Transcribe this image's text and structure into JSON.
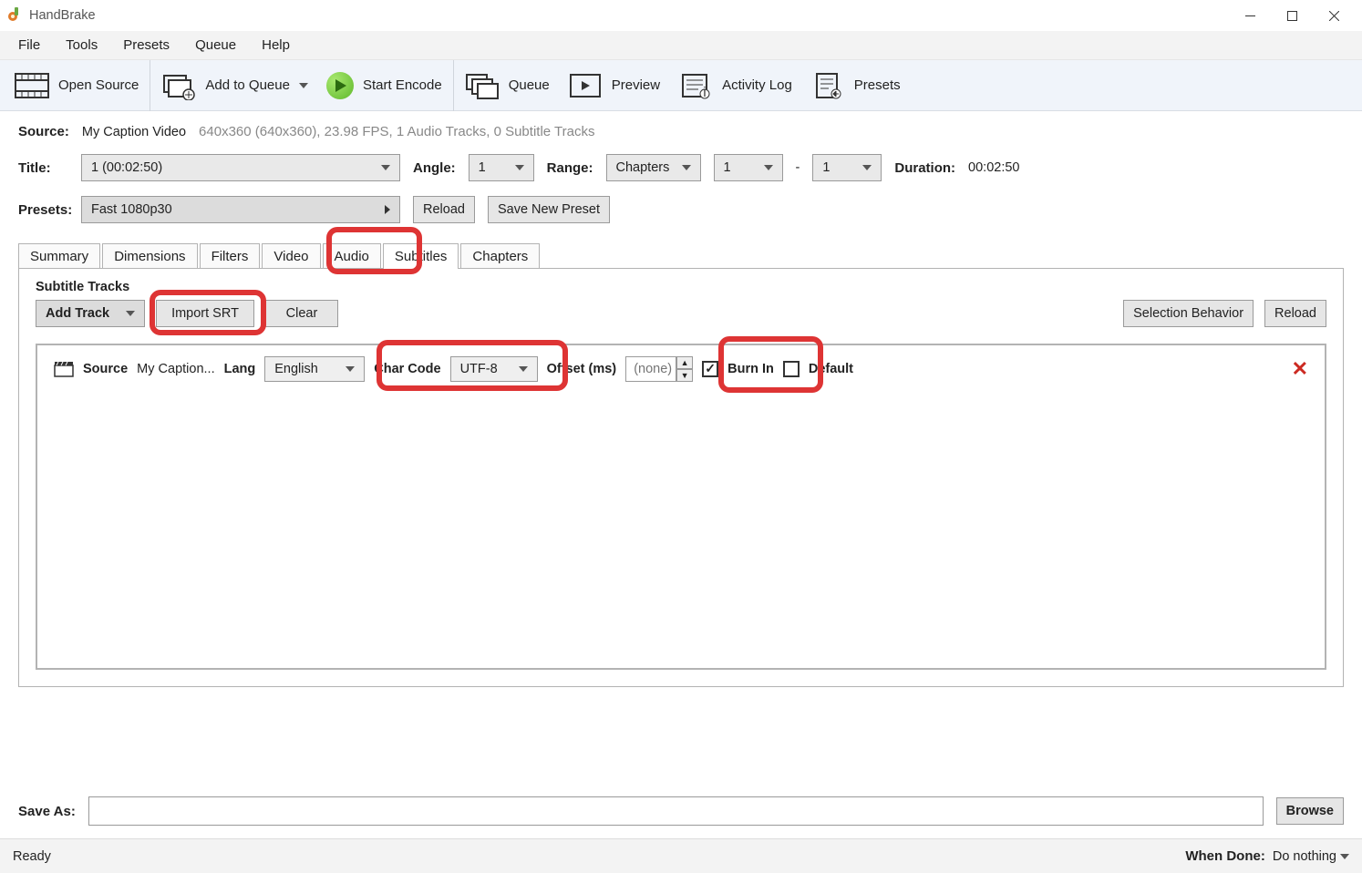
{
  "window": {
    "title": "HandBrake"
  },
  "menu": {
    "file": "File",
    "tools": "Tools",
    "presets": "Presets",
    "queue": "Queue",
    "help": "Help"
  },
  "toolbar": {
    "open_source": "Open Source",
    "add_to_queue": "Add to Queue",
    "start_encode": "Start Encode",
    "queue": "Queue",
    "preview": "Preview",
    "activity_log": "Activity Log",
    "presets": "Presets"
  },
  "source": {
    "label": "Source:",
    "name": "My Caption Video",
    "details": "640x360 (640x360), 23.98 FPS, 1 Audio Tracks, 0 Subtitle Tracks"
  },
  "title": {
    "label": "Title:",
    "value": "1 (00:02:50)"
  },
  "angle": {
    "label": "Angle:",
    "value": "1"
  },
  "range": {
    "label": "Range:",
    "type": "Chapters",
    "from": "1",
    "to": "1",
    "dash": "-"
  },
  "duration": {
    "label": "Duration:",
    "value": "00:02:50"
  },
  "presets": {
    "label": "Presets:",
    "value": "Fast 1080p30",
    "reload": "Reload",
    "save": "Save New Preset"
  },
  "tabs": {
    "summary": "Summary",
    "dimensions": "Dimensions",
    "filters": "Filters",
    "video": "Video",
    "audio": "Audio",
    "subtitles": "Subtitles",
    "chapters": "Chapters"
  },
  "subtitles": {
    "heading": "Subtitle Tracks",
    "add_track": "Add Track",
    "import_srt": "Import SRT",
    "clear": "Clear",
    "selection_behavior": "Selection Behavior",
    "reload": "Reload",
    "row": {
      "source_label": "Source",
      "source_value": "My Caption...",
      "lang_label": "Lang",
      "lang_value": "English",
      "charcode_label": "Char Code",
      "charcode_value": "UTF-8",
      "offset_label": "Offset (ms)",
      "offset_placeholder": "(none)",
      "burnin_label": "Burn In",
      "default_label": "Default"
    }
  },
  "save": {
    "label": "Save As:",
    "browse": "Browse",
    "value": ""
  },
  "status": {
    "ready": "Ready",
    "when_done_label": "When Done:",
    "when_done_value": "Do nothing"
  }
}
